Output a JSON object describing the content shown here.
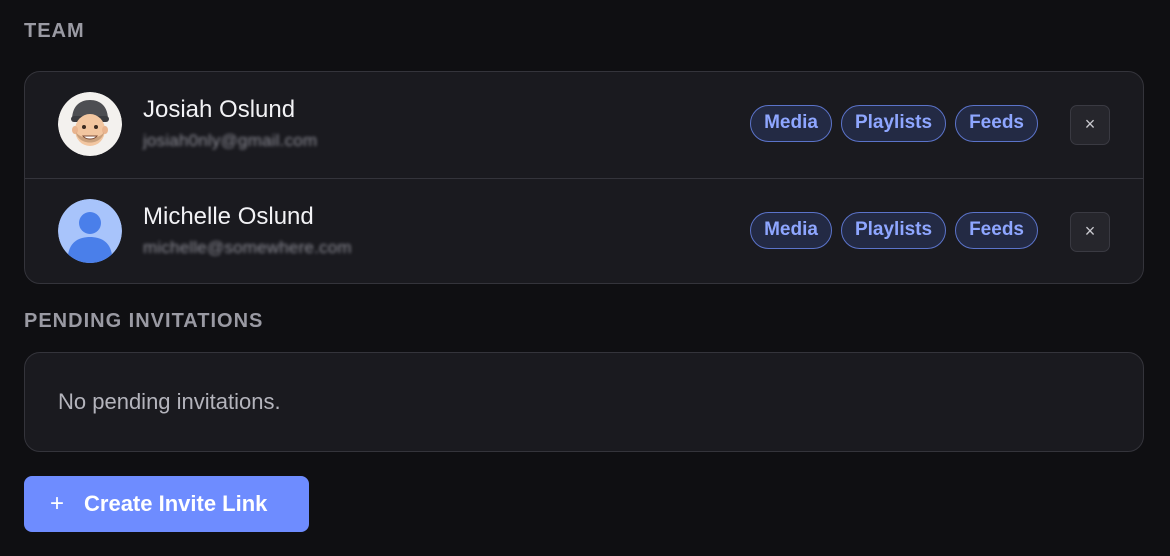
{
  "team": {
    "heading": "TEAM",
    "members": [
      {
        "name": "Josiah Oslund",
        "email": "josiah0nly@gmail.com",
        "avatar": "memoji-avatar",
        "permissions": [
          "Media",
          "Playlists",
          "Feeds"
        ],
        "remove_label": "×"
      },
      {
        "name": "Michelle Oslund",
        "email": "michelle@somewhere.com",
        "avatar": "default-person-avatar",
        "permissions": [
          "Media",
          "Playlists",
          "Feeds"
        ],
        "remove_label": "×"
      }
    ]
  },
  "pending": {
    "heading": "PENDING INVITATIONS",
    "empty_message": "No pending invitations."
  },
  "invite_button": {
    "icon": "plus-icon",
    "plus_glyph": "+",
    "label": "Create Invite Link"
  },
  "colors": {
    "background": "#0f0f12",
    "card": "#1a1a1f",
    "chip_border": "#5b73c9",
    "chip_text": "#8ea6ff",
    "accent_button": "#6e8cff"
  }
}
